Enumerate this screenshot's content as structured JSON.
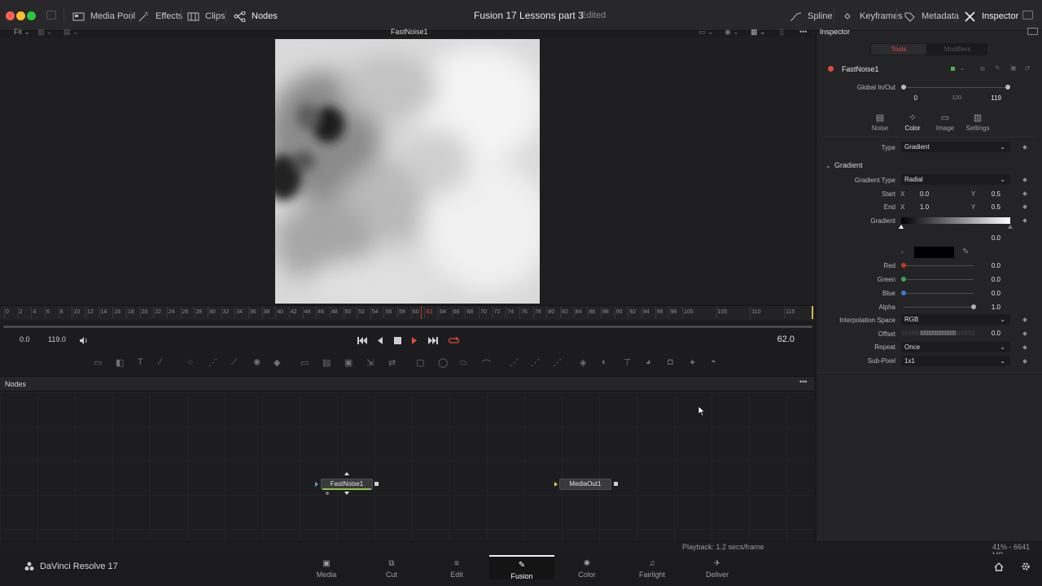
{
  "window": {
    "project_title": "Fusion 17 Lessons part 3",
    "project_status": "Edited"
  },
  "topbar": {
    "left_buttons": [
      {
        "label": "Media Pool",
        "icon": "media-pool-icon"
      },
      {
        "label": "Effects",
        "icon": "effects-icon"
      },
      {
        "label": "Clips",
        "icon": "clips-icon"
      },
      {
        "label": "Nodes",
        "icon": "nodes-icon"
      }
    ],
    "right_buttons": [
      {
        "label": "Spline",
        "icon": "spline-icon"
      },
      {
        "label": "Keyframes",
        "icon": "keyframes-icon"
      },
      {
        "label": "Metadata",
        "icon": "metadata-icon"
      },
      {
        "label": "Inspector",
        "icon": "inspector-icon"
      }
    ]
  },
  "viewer": {
    "fit_label": "Fit",
    "title": "FastNoise1"
  },
  "ruler": {
    "ticks": [
      "0",
      "2",
      "4",
      "6",
      "8",
      "10",
      "12",
      "14",
      "16",
      "18",
      "20",
      "22",
      "24",
      "26",
      "28",
      "30",
      "32",
      "34",
      "36",
      "38",
      "40",
      "42",
      "44",
      "46",
      "48",
      "50",
      "52",
      "54",
      "56",
      "58",
      "60",
      "62",
      "64",
      "66",
      "68",
      "70",
      "72",
      "74",
      "76",
      "78",
      "80",
      "82",
      "84",
      "86",
      "88",
      "90",
      "92",
      "94",
      "96",
      "98",
      "100",
      "105",
      "110",
      "115"
    ],
    "current": "62"
  },
  "transport": {
    "start_time": "0.0",
    "end_time": "119.0",
    "current_frame": "62.0"
  },
  "nodes_panel": {
    "title": "Nodes",
    "nodes": [
      {
        "label": "FastNoise1"
      },
      {
        "label": "MediaOut1"
      }
    ]
  },
  "status": {
    "playback": "Playback: 1.2 secs/frame",
    "memory": "41% - 6641 MB"
  },
  "pages": {
    "brand": "DaVinci Resolve 17",
    "tabs": [
      {
        "label": "Media",
        "icon": "media-page-icon"
      },
      {
        "label": "Cut",
        "icon": "cut-page-icon"
      },
      {
        "label": "Edit",
        "icon": "edit-page-icon"
      },
      {
        "label": "Fusion",
        "icon": "fusion-page-icon"
      },
      {
        "label": "Color",
        "icon": "color-page-icon"
      },
      {
        "label": "Fairlight",
        "icon": "fairlight-page-icon"
      },
      {
        "label": "Deliver",
        "icon": "deliver-page-icon"
      }
    ],
    "active": "Fusion"
  },
  "inspector": {
    "title": "Inspector",
    "tab_tools": "Tools",
    "tab_modifiers": "Modifiers",
    "node_name": "FastNoise1",
    "global_inout": {
      "label": "Global In/Out",
      "start": "0",
      "mid": "120",
      "end": "119"
    },
    "subtabs": [
      {
        "label": "Noise",
        "icon": "noise-tab-icon"
      },
      {
        "label": "Color",
        "icon": "color-tab-icon"
      },
      {
        "label": "Image",
        "icon": "image-tab-icon"
      },
      {
        "label": "Settings",
        "icon": "settings-tab-icon"
      }
    ],
    "active_subtab": "Color",
    "type": {
      "label": "Type",
      "value": "Gradient"
    },
    "gradient_section": "Gradient",
    "gradient_type": {
      "label": "Gradient Type",
      "value": "Radial"
    },
    "start": {
      "label": "Start",
      "x_label": "X",
      "x": "0.0",
      "y_label": "Y",
      "y": "0.5"
    },
    "end": {
      "label": "End",
      "x_label": "X",
      "x": "1.0",
      "y_label": "Y",
      "y": "0.5"
    },
    "gradient_bar_label": "Gradient",
    "gradient_pos": "0.0",
    "channels": [
      {
        "label": "Red",
        "value": "0.0",
        "color": "#c0392b",
        "level": 0
      },
      {
        "label": "Green",
        "value": "0.0",
        "color": "#3aa64a",
        "level": 0
      },
      {
        "label": "Blue",
        "value": "0.0",
        "color": "#3a78c9",
        "level": 0
      },
      {
        "label": "Alpha",
        "value": "1.0",
        "color": "#b0b0b0",
        "level": 1
      }
    ],
    "interpolation": {
      "label": "Interpolation Space",
      "value": "RGB"
    },
    "offset": {
      "label": "Offset",
      "value": "0.0"
    },
    "repeat": {
      "label": "Repeat",
      "value": "Once"
    },
    "subpixel": {
      "label": "Sub-Pixel",
      "value": "1x1"
    }
  },
  "colors": {
    "accent_red": "#e04a3f",
    "active_tab": "#ffffff"
  }
}
